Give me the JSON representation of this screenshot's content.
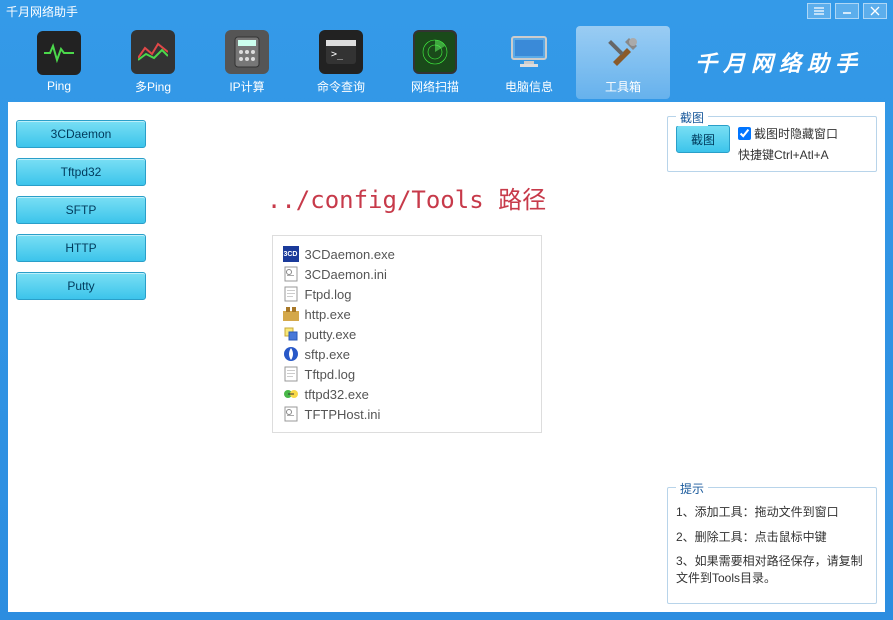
{
  "window": {
    "title": "千月网络助手",
    "brand": "千月网络助手"
  },
  "toolbar": {
    "items": [
      {
        "label": "Ping",
        "name": "ping"
      },
      {
        "label": "多Ping",
        "name": "multi-ping"
      },
      {
        "label": "IP计算",
        "name": "ip-calc"
      },
      {
        "label": "命令查询",
        "name": "cmd-query"
      },
      {
        "label": "网络扫描",
        "name": "net-scan"
      },
      {
        "label": "电脑信息",
        "name": "pc-info"
      },
      {
        "label": "工具箱",
        "name": "toolbox"
      }
    ]
  },
  "tools": {
    "buttons": [
      "3CDaemon",
      "Tftpd32",
      "SFTP",
      "HTTP",
      "Putty"
    ]
  },
  "center": {
    "path_label": "../config/Tools 路径",
    "files": [
      {
        "name": "3CDaemon.exe",
        "icon": "exe-3cd"
      },
      {
        "name": "3CDaemon.ini",
        "icon": "ini"
      },
      {
        "name": "Ftpd.log",
        "icon": "log"
      },
      {
        "name": "http.exe",
        "icon": "exe-http"
      },
      {
        "name": "putty.exe",
        "icon": "exe-putty"
      },
      {
        "name": "sftp.exe",
        "icon": "exe-sftp"
      },
      {
        "name": "Tftpd.log",
        "icon": "log"
      },
      {
        "name": "tftpd32.exe",
        "icon": "exe-tftpd"
      },
      {
        "name": "TFTPHost.ini",
        "icon": "ini"
      }
    ]
  },
  "screenshot": {
    "legend": "截图",
    "button": "截图",
    "checkbox_label": "截图时隐藏窗口",
    "checkbox_checked": true,
    "shortcut": "快捷键Ctrl+Atl+A"
  },
  "tips": {
    "legend": "提示",
    "lines": [
      "1、添加工具：拖动文件到窗口",
      "2、删除工具：点击鼠标中键",
      "3、如果需要相对路径保存，请复制文件到Tools目录。"
    ]
  }
}
